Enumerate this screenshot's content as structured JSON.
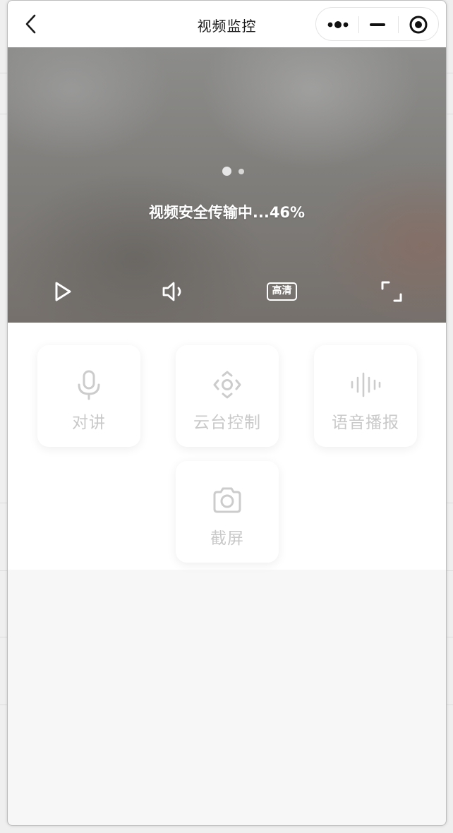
{
  "app": {
    "title": "视频监控"
  },
  "capsule": {
    "more_icon": "more-dots-icon",
    "minimize_icon": "minimize-icon",
    "close_icon": "close-target-icon"
  },
  "video": {
    "loading_text": "视频安全传输中...46%",
    "loading_progress_percent": 46,
    "controls": {
      "play_icon": "play-icon",
      "volume_icon": "volume-icon",
      "quality_label": "高清",
      "fullscreen_icon": "fullscreen-icon"
    }
  },
  "functions": [
    {
      "label": "对讲",
      "icon": "microphone-icon"
    },
    {
      "label": "云台控制",
      "icon": "ptz-control-icon"
    },
    {
      "label": "语音播报",
      "icon": "voice-wave-icon"
    },
    {
      "label": "截屏",
      "icon": "camera-icon"
    }
  ],
  "colors": {
    "function_label": "#c9c9c9",
    "function_icon": "#cccccc",
    "video_overlay_text": "#ffffff"
  }
}
